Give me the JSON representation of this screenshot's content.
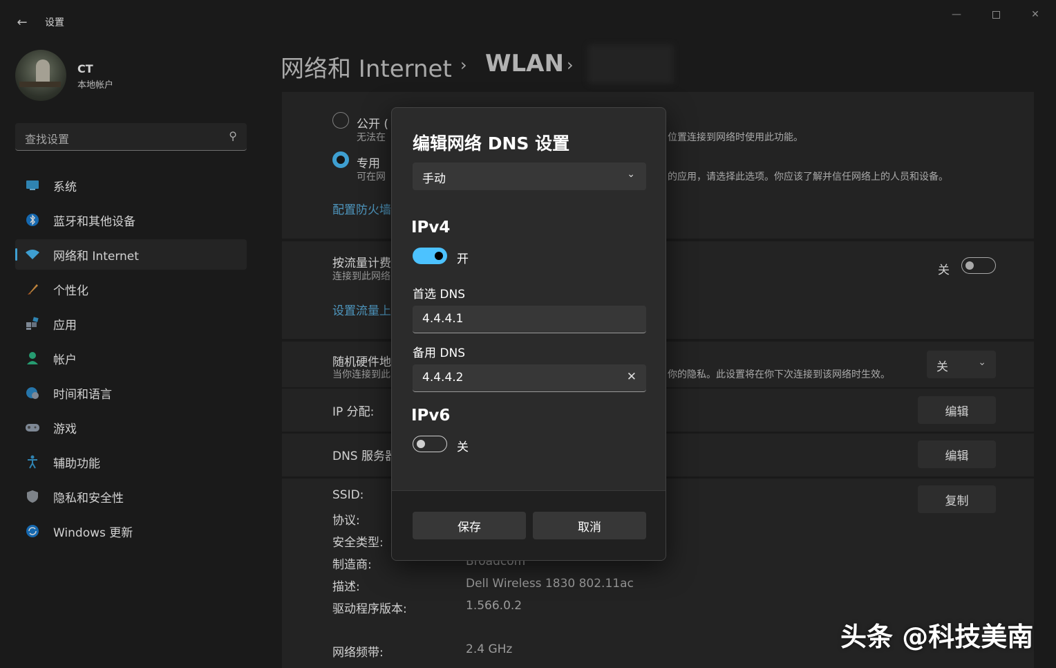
{
  "titlebar": {
    "title": "设置"
  },
  "user": {
    "name": "CT",
    "type": "本地帐户"
  },
  "search": {
    "placeholder": "查找设置"
  },
  "sidebar": {
    "items": [
      {
        "label": "系统",
        "icon": "monitor-icon"
      },
      {
        "label": "蓝牙和其他设备",
        "icon": "bluetooth-icon"
      },
      {
        "label": "网络和 Internet",
        "icon": "wifi-icon",
        "active": true
      },
      {
        "label": "个性化",
        "icon": "brush-icon"
      },
      {
        "label": "应用",
        "icon": "apps-icon"
      },
      {
        "label": "帐户",
        "icon": "person-icon"
      },
      {
        "label": "时间和语言",
        "icon": "globe-clock-icon"
      },
      {
        "label": "游戏",
        "icon": "gamepad-icon"
      },
      {
        "label": "辅助功能",
        "icon": "accessibility-icon"
      },
      {
        "label": "隐私和安全性",
        "icon": "shield-icon"
      },
      {
        "label": "Windows 更新",
        "icon": "update-icon"
      }
    ]
  },
  "breadcrumb": {
    "level1": "网络和 Internet",
    "level2": "WLAN",
    "sep": "›"
  },
  "profile": {
    "public_title": "公开 (",
    "public_desc": "无法在",
    "public_tail": "位置连接到网络时使用此功能。",
    "private_title": "专用",
    "private_desc": "可在网",
    "private_tail": "的应用，请选择此选项。你应该了解并信任网络上的人员和设备。",
    "firewall_link": "配置防火墙"
  },
  "metered": {
    "title": "按流量计费",
    "desc": "连接到此网络",
    "state": "关",
    "link": "设置流量上"
  },
  "random_hw": {
    "title": "随机硬件地",
    "desc": "当你连接到此",
    "tail": "你的隐私。此设置将在你下次连接到该网络时生效。",
    "value": "关"
  },
  "ip_assign": {
    "label": "IP 分配:",
    "button": "编辑"
  },
  "dns_server": {
    "label": "DNS 服务器",
    "button": "编辑"
  },
  "properties": {
    "copy_button": "复制",
    "rows": [
      {
        "key": "SSID:",
        "value": ""
      },
      {
        "key": "协议:",
        "value": ""
      },
      {
        "key": "安全类型:",
        "value": ""
      },
      {
        "key": "制造商:",
        "value": "Broadcom"
      },
      {
        "key": "描述:",
        "value": "Dell Wireless 1830 802.11ac"
      },
      {
        "key": "驱动程序版本:",
        "value": "1.566.0.2"
      },
      {
        "key": "网络频带:",
        "value": "2.4 GHz"
      }
    ]
  },
  "dialog": {
    "title": "编辑网络 DNS 设置",
    "mode": "手动",
    "ipv4": {
      "heading": "IPv4",
      "toggle_label": "开",
      "enabled": true,
      "preferred_label": "首选 DNS",
      "preferred_value": "4.4.4.1",
      "alternate_label": "备用 DNS",
      "alternate_value": "4.4.4.2"
    },
    "ipv6": {
      "heading": "IPv6",
      "toggle_label": "关",
      "enabled": false
    },
    "save": "保存",
    "cancel": "取消"
  },
  "watermark": "头条 @科技美南",
  "colors": {
    "accent": "#4cc2ff",
    "background": "#202020",
    "card": "#2b2b2b",
    "link": "#60b8e8"
  }
}
